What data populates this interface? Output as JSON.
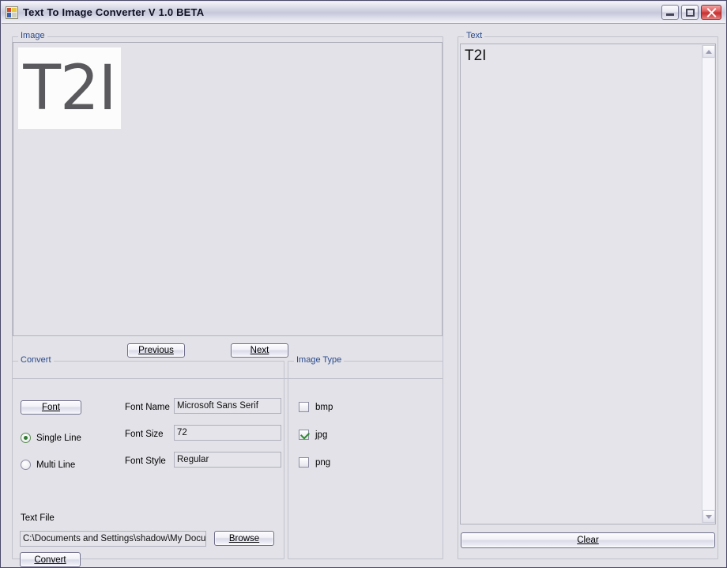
{
  "window": {
    "title": "Text To Image Converter V 1.0 BETA",
    "icon": "app-icon",
    "controls": {
      "minimize": "minimize-button",
      "maximize": "maximize-button",
      "close": "close-button"
    }
  },
  "image_group": {
    "label": "Image",
    "preview_text": "T2I",
    "previous_label": "Previous",
    "next_label": "Next"
  },
  "convert_group": {
    "label": "Convert",
    "font_button_label": "Font",
    "radios": [
      {
        "label": "Single Line",
        "selected": true
      },
      {
        "label": "Multi Line",
        "selected": false
      }
    ],
    "fields": [
      {
        "label": "Font Name",
        "value": "Microsoft Sans Serif"
      },
      {
        "label": "Font Size",
        "value": "72"
      },
      {
        "label": "Font Style",
        "value": "Regular"
      }
    ],
    "text_file_label": "Text File",
    "text_file_value": "C:\\Documents and Settings\\shadow\\My Docume",
    "browse_label": "Browse",
    "convert_label": "Convert"
  },
  "image_type_group": {
    "label": "Image Type",
    "options": [
      {
        "label": "bmp",
        "checked": false
      },
      {
        "label": "jpg",
        "checked": true
      },
      {
        "label": "png",
        "checked": false
      }
    ]
  },
  "text_group": {
    "label": "Text",
    "content": "T2I",
    "clear_label": "Clear"
  },
  "colors": {
    "window_bg": "#e2e2e8",
    "group_label": "#2b4a8b",
    "close_button": "#c62f2f",
    "check_green": "#2f8a30",
    "radio_green": "#2f7a2f",
    "preview_text": "#5a5a5e"
  }
}
